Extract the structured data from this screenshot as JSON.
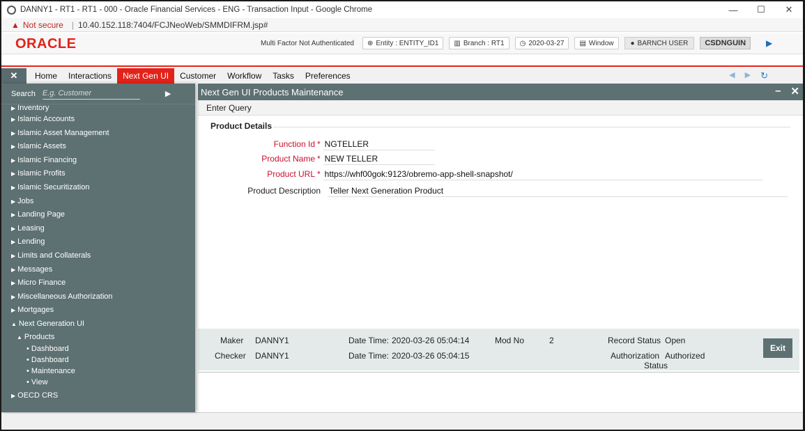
{
  "browser": {
    "window_title": "DANNY1 - RT1 - RT1 - 000 - Oracle Financial Services - ENG - Transaction Input - Google Chrome",
    "not_secure": "Not secure",
    "url": "10.40.152.118:7404/FCJNeoWeb/SMMDIFRM.jsp#",
    "minimize": "—",
    "maximize": "☐",
    "close": "✕"
  },
  "header": {
    "logo": "ORACLE",
    "mfa_status": "Multi Factor Not Authenticated",
    "entity": "Entity : ENTITY_ID1",
    "branch": "Branch : RT1",
    "date": "2020-03-27",
    "window": "Window",
    "user": "BARNCH USER",
    "user_code": "CSDNGUIN"
  },
  "menubar": {
    "close": "✕",
    "items": [
      "Home",
      "Interactions",
      "Next Gen UI",
      "Customer",
      "Workflow",
      "Tasks",
      "Preferences"
    ],
    "active_index": 2
  },
  "sidebar": {
    "search_label": "Search",
    "search_placeholder": "E.g. Customer",
    "items": [
      "Inventory",
      "Islamic Accounts",
      "Islamic Asset Management",
      "Islamic Assets",
      "Islamic Financing",
      "Islamic Profits",
      "Islamic Securitization",
      "Jobs",
      "Landing Page",
      "Leasing",
      "Lending",
      "Limits and Collaterals",
      "Messages",
      "Micro Finance",
      "Miscellaneous Authorization",
      "Mortgages",
      "Next Generation UI"
    ],
    "sub": {
      "products": "Products",
      "leaves": [
        "Dashboard",
        "Dashboard",
        "Maintenance",
        "View"
      ]
    },
    "last": "OECD CRS"
  },
  "panel": {
    "title": "Next Gen UI Products Maintenance",
    "toolbar": "Enter Query",
    "section": "Product Details",
    "fields": {
      "function_id_label": "Function Id",
      "function_id": "NGTELLER",
      "product_name_label": "Product Name",
      "product_name": "NEW TELLER",
      "product_url_label": "Product URL",
      "product_url": "https://whf00gok:9123/obremo-app-shell-snapshot/",
      "product_desc_label": "Product Description",
      "product_desc": "Teller Next Generation Product"
    }
  },
  "audit": {
    "maker_label": "Maker",
    "maker": "DANNY1",
    "maker_dt_label": "Date Time:",
    "maker_dt": "2020-03-26 05:04:14",
    "checker_label": "Checker",
    "checker": "DANNY1",
    "checker_dt_label": "Date Time:",
    "checker_dt": "2020-03-26 05:04:15",
    "mod_label": "Mod No",
    "mod": "2",
    "record_label": "Record Status",
    "record": "Open",
    "auth_label": "Authorization Status",
    "auth_line1": "Authorization",
    "auth_line2": "Status",
    "auth": "Authorized",
    "exit": "Exit"
  }
}
